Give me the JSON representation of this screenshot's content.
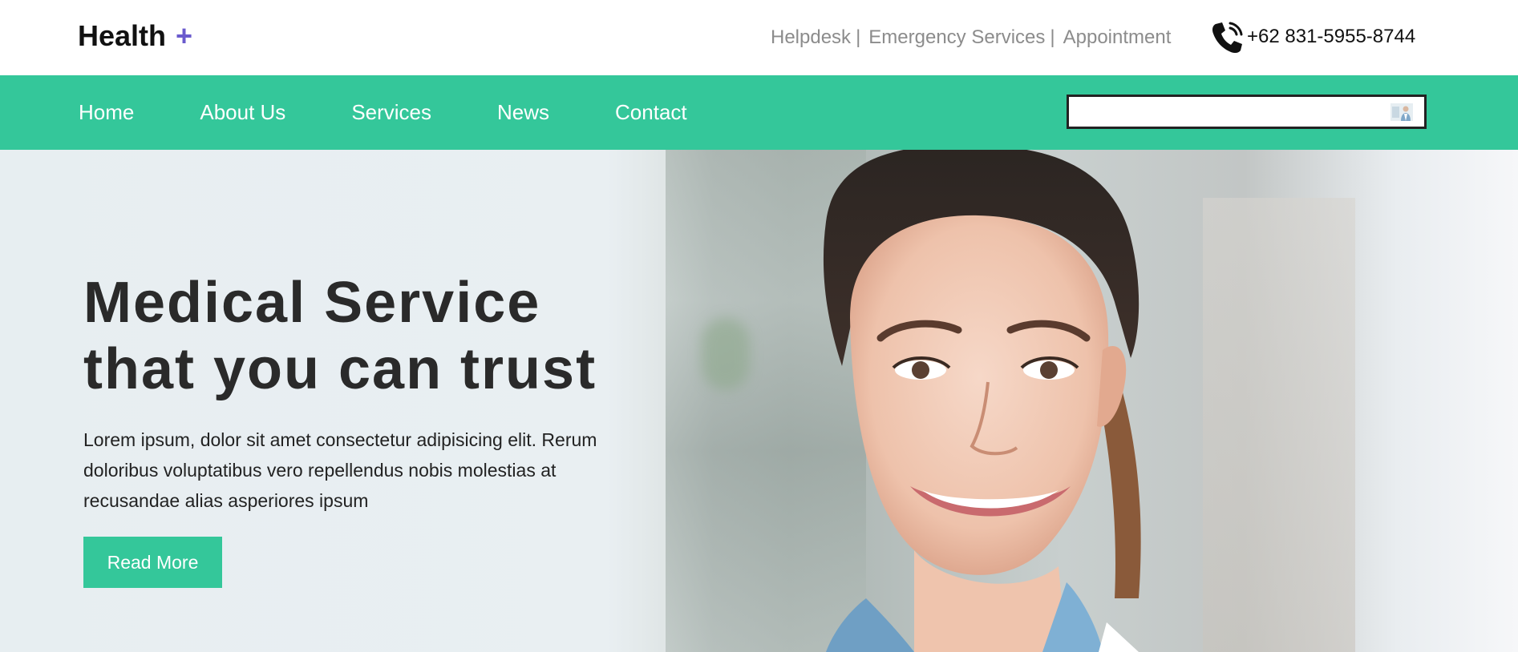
{
  "brand": {
    "name": "Health",
    "plus": "+"
  },
  "topbar": {
    "links": [
      "Helpdesk",
      "Emergency Services",
      "Appointment"
    ],
    "separator": "|",
    "phone": "+62 831-5955-8744",
    "phone_icon": "phone-icon"
  },
  "nav": {
    "items": [
      "Home",
      "About Us",
      "Services",
      "News",
      "Contact"
    ],
    "search_placeholder": "",
    "search_icon": "search-image-icon"
  },
  "hero": {
    "title_line1": "Medical Service",
    "title_line2": "that you can trust",
    "text": "Lorem ipsum, dolor sit amet consectetur adipisicing elit. Rerum doloribus voluptatibus vero repellendus nobis molestias at recusandae alias asperiores ipsum",
    "button": "Read More",
    "image": "smiling-doctor-photo"
  },
  "colors": {
    "accent": "#34c79a",
    "plus": "#6a5acd",
    "title": "#2a2a2a",
    "muted_link": "#8c8c8c"
  }
}
